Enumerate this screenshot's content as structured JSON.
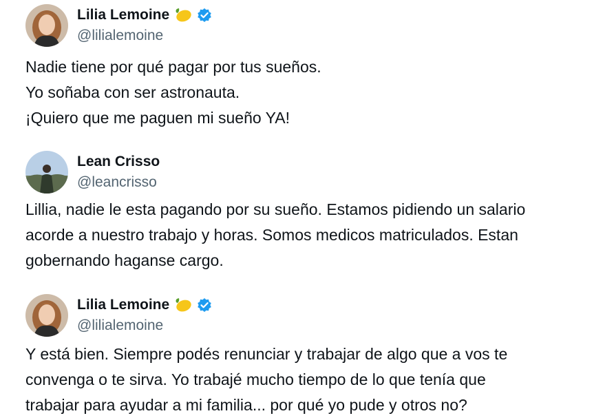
{
  "tweets": [
    {
      "author": {
        "name": "Lilia Lemoine",
        "handle": "@lilialemoine",
        "name_emoji": "lemon-icon",
        "verified_icon": "verified-badge-icon",
        "verified_color": "#1d9bf0"
      },
      "lines": [
        "Nadie tiene por qué pagar por tus sueños.",
        "Yo soñaba con ser astronauta.",
        "¡Quiero que me paguen mi sueño YA!"
      ]
    },
    {
      "author": {
        "name": "Lean Crisso",
        "handle": "@leancrisso"
      },
      "lines": [
        "Lillia, nadie le esta pagando por su sueño. Estamos pidiendo un salario",
        "acorde a nuestro trabajo y horas. Somos medicos matriculados. Estan",
        "gobernando haganse cargo."
      ]
    },
    {
      "author": {
        "name": "Lilia Lemoine",
        "handle": "@lilialemoine",
        "name_emoji": "lemon-icon",
        "verified_icon": "verified-badge-icon",
        "verified_color": "#1d9bf0"
      },
      "lines": [
        "Y está bien. Siempre podés renunciar y trabajar de algo que a vos te",
        "convenga o te sirva. Yo trabajé mucho tiempo de lo que tenía que",
        "trabajar para ayudar a mi familia... por qué yo pude y otros no?"
      ]
    }
  ]
}
